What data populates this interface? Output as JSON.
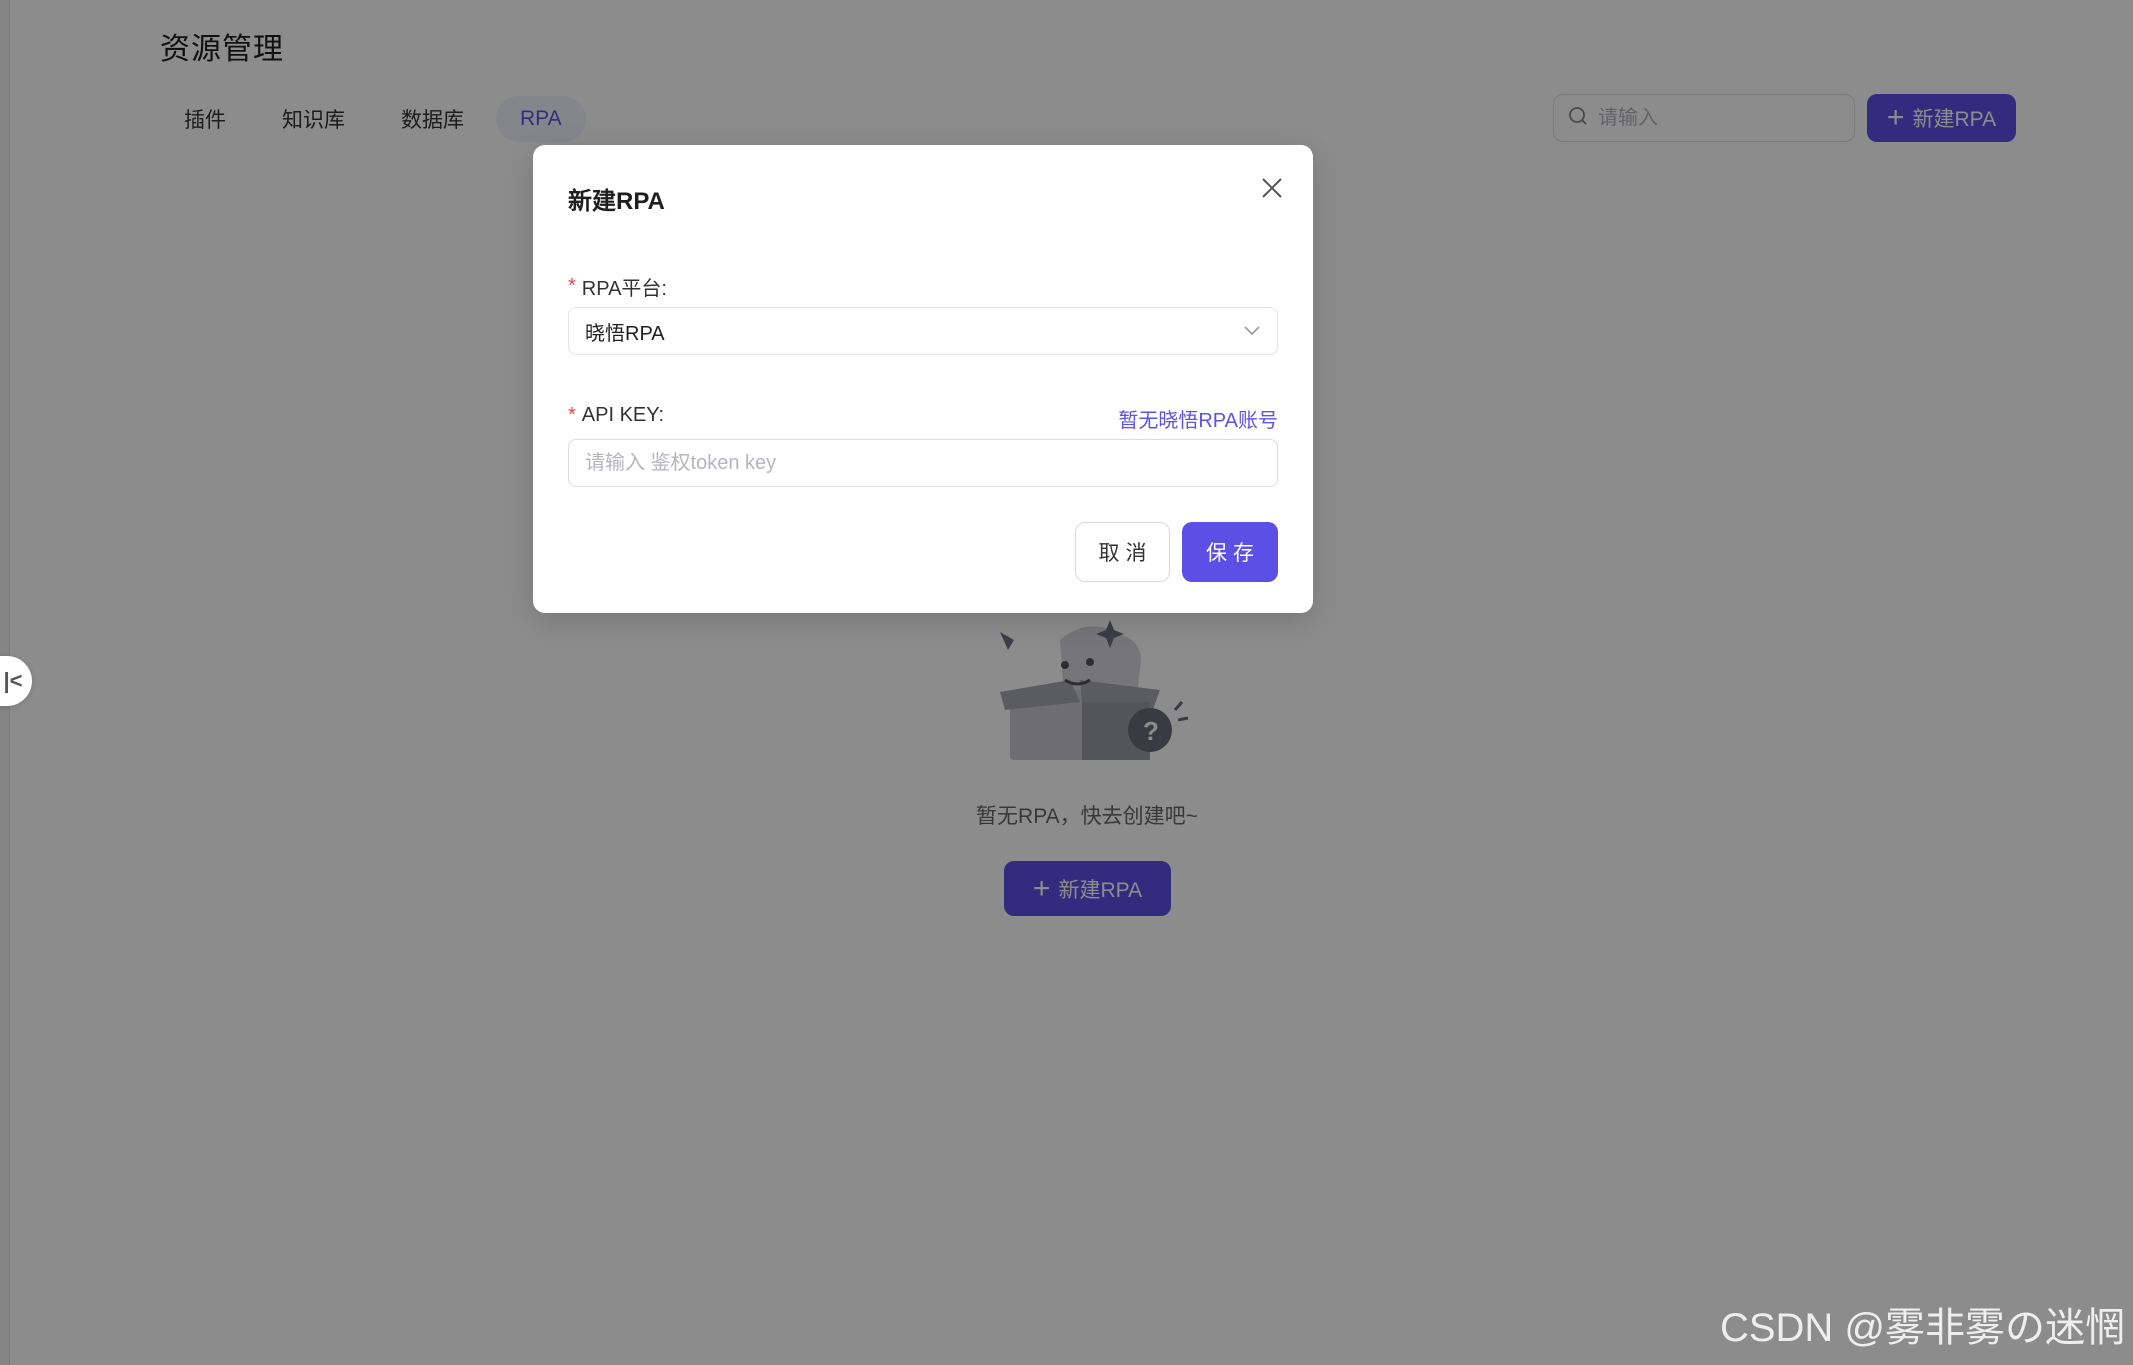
{
  "page": {
    "title": "资源管理"
  },
  "tabs": [
    {
      "label": "插件",
      "active": false
    },
    {
      "label": "知识库",
      "active": false
    },
    {
      "label": "数据库",
      "active": false
    },
    {
      "label": "RPA",
      "active": true
    }
  ],
  "search": {
    "placeholder": "请输入"
  },
  "toolbar": {
    "new_button_label": "新建RPA"
  },
  "empty_state": {
    "message": "暂无RPA，快去创建吧~",
    "new_button_label": "新建RPA"
  },
  "modal": {
    "title": "新建RPA",
    "platform_label": "RPA平台:",
    "platform_value": "晓悟RPA",
    "api_key_label": "API KEY:",
    "api_key_link": "暂无晓悟RPA账号",
    "api_key_placeholder": "请输入 鉴权token key",
    "api_key_value": "",
    "cancel_label": "取消",
    "save_label": "保存"
  },
  "watermark": "CSDN @雾非雾の迷惘",
  "colors": {
    "accent": "#5b4fe6",
    "required": "#ef4444",
    "overlay": "rgba(0,0,0,0.45)"
  },
  "icons": {
    "collapse": "collapse-left-icon",
    "search": "search-icon",
    "plus": "plus-icon",
    "close": "close-icon",
    "dropdown": "chevron-down-icon",
    "empty": "empty-box-icon"
  }
}
